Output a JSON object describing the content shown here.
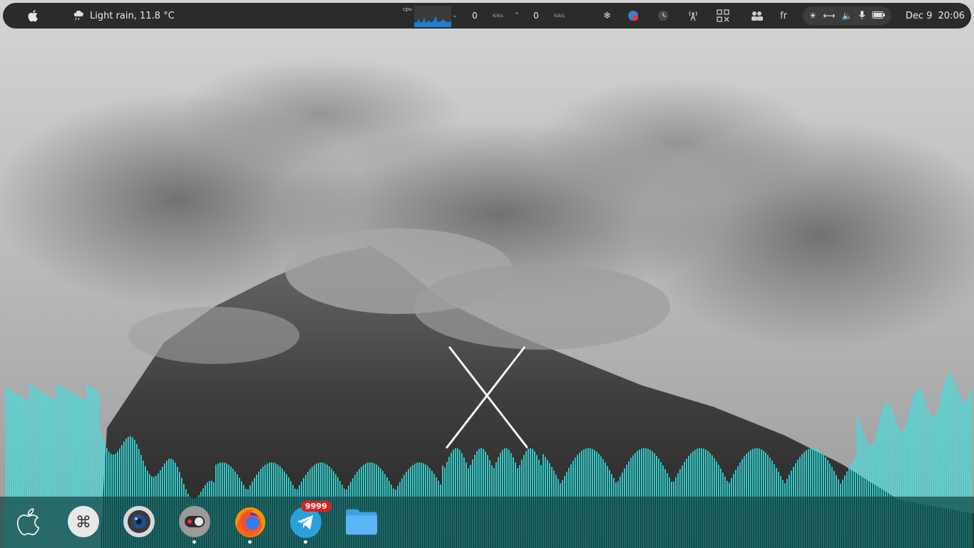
{
  "topbar": {
    "apple_icon": "apple-icon",
    "weather": {
      "icon": "rain-cloud-icon",
      "text": "Light rain, 11.8 °C"
    },
    "cpu": {
      "label": "cpu"
    },
    "network": {
      "down_value": "0",
      "down_unit": "KiB/s",
      "up_value": "0",
      "up_unit": "KiB/s"
    },
    "keyboard_layout": "fr",
    "clock": {
      "date": "Dec 9",
      "time": "20:06"
    },
    "tray_icons": [
      "snowflake-icon",
      "notification-record-icon",
      "clock-icon",
      "signal-tower-icon",
      "grid-icon",
      "people-icon"
    ],
    "quick_settings": [
      "brightness-icon",
      "network-icon",
      "volume-icon",
      "microphone-icon",
      "battery-icon"
    ]
  },
  "dock": {
    "items": [
      {
        "name": "apple-logo",
        "running": false
      },
      {
        "name": "command-launcher",
        "running": false
      },
      {
        "name": "camera-app",
        "running": false
      },
      {
        "name": "toggle-app",
        "running": true
      },
      {
        "name": "firefox",
        "running": true
      },
      {
        "name": "telegram",
        "running": true,
        "badge": "9999"
      },
      {
        "name": "files",
        "running": false
      }
    ]
  },
  "colors": {
    "panel_bg": "#2b2b2b",
    "dock_bg": "#124646",
    "visualizer": "#33e6e6",
    "badge": "#e02020"
  }
}
